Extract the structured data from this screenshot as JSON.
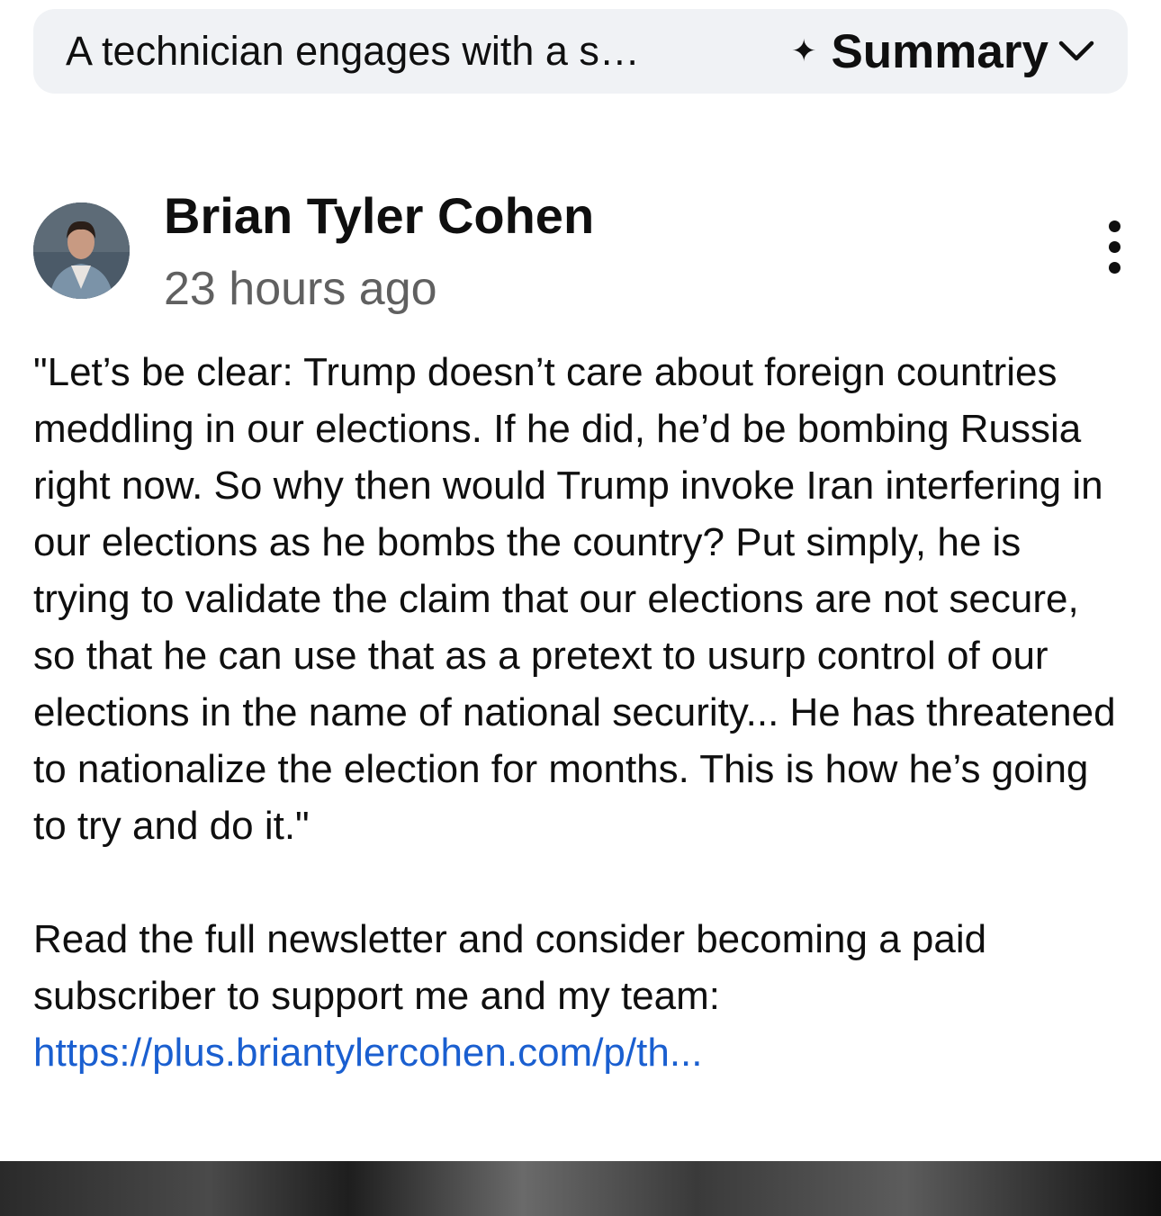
{
  "summary_bar": {
    "text": "A technician engages with a s…",
    "button_label": "Summary",
    "sparkle_icon": "sparkle-icon",
    "chevron_icon": "chevron-down-icon"
  },
  "post": {
    "author": "Brian Tyler Cohen",
    "timestamp": "23 hours ago",
    "quote": "\"Let’s be clear: Trump doesn’t care about foreign countries meddling in our elections. If he did, he’d be bombing Russia right now. So why then would Trump invoke Iran interfering in our elections as he bombs the country? Put simply, he is trying to validate the claim that our elections are not secure, so that he can use that as a pretext to usurp control of our elections in the name of national security... He has threatened to nationalize the election for months. This is how he’s going to try and do it.\"",
    "cta_text": "Read the full newsletter and consider becoming a paid subscriber to support me and my team: ",
    "link_text": "https://plus.briantylercohen.com/p/th...",
    "link_color": "#1a5fd0"
  }
}
